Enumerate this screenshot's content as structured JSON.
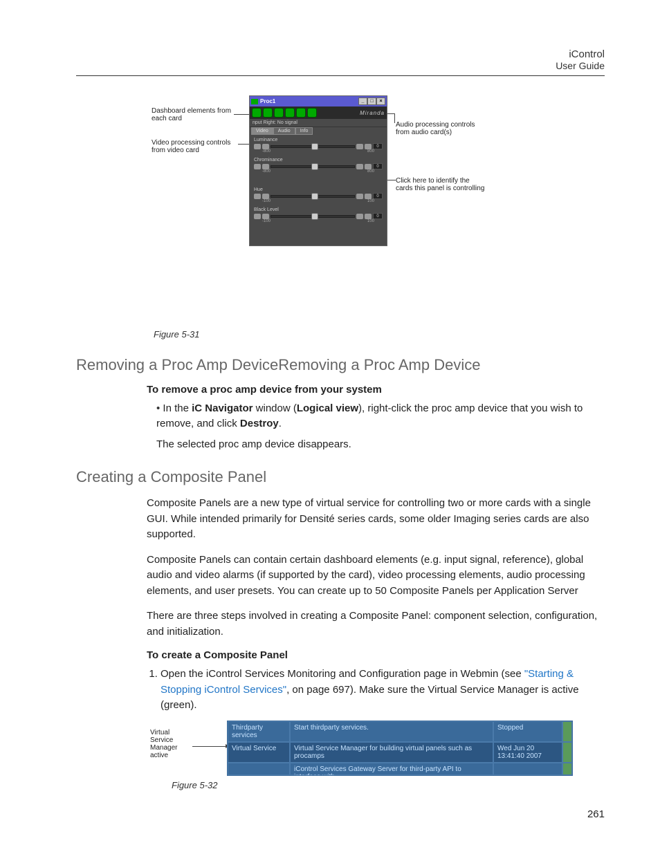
{
  "header": {
    "title": "iControl",
    "sub": "User Guide"
  },
  "figure531": {
    "caption": "Figure 5-31",
    "window_title": "Proc1",
    "brand": "Miranda",
    "signal_row": "nput Right: No signal",
    "tabs": [
      "Video",
      "Audio",
      "Info"
    ],
    "sliders": [
      {
        "label": "Luminance",
        "min": "-800",
        "max": "800",
        "val": "0"
      },
      {
        "label": "Chrominance",
        "min": "-800",
        "max": "800",
        "val": "0"
      },
      {
        "label": "Hue",
        "min": "-100",
        "max": "100",
        "val": "0"
      },
      {
        "label": "Black Level",
        "min": "-100",
        "max": "100",
        "val": "0"
      }
    ],
    "callouts": {
      "dashboard": "Dashboard elements from each card",
      "video": "Video processing controls from video card",
      "audio": "Audio processing controls from audio card(s)",
      "identify": "Click here to identify the cards this panel is controlling"
    }
  },
  "section1": {
    "heading": "Removing a Proc Amp DeviceRemoving a Proc Amp Device",
    "bold": "To remove a proc amp device from your system",
    "bullet_prefix": "In the ",
    "bullet_b1": "iC Navigator",
    "bullet_mid1": " window (",
    "bullet_b2": "Logical view",
    "bullet_mid2": "), right-click the proc amp device that you wish to remove, and click ",
    "bullet_b3": "Destroy",
    "bullet_end": ".",
    "sub": "The selected proc amp device disappears."
  },
  "section2": {
    "heading": "Creating a Composite Panel",
    "p1": "Composite Panels are a new type of virtual service for controlling two or more cards with a single GUI. While intended primarily for Densité series cards, some older Imaging series cards are also supported.",
    "p2": "Composite Panels can contain certain dashboard elements (e.g. input signal, reference), global audio and video alarms (if supported by the card), video processing elements, audio processing elements, and user presets. You can create up to 50 Composite Panels per Application Server",
    "p3": "There are three steps involved in creating a Composite Panel: component selection, configuration, and initialization.",
    "bold": "To create a Composite Panel",
    "li1_a": "Open the iControl Services Monitoring and Configuration page in Webmin (see ",
    "li1_link": "\"Starting & Stopping iControl Services\"",
    "li1_b": ", on page 697). Make sure the Virtual Service Manager is active (green)."
  },
  "figure532": {
    "caption": "Figure 5-32",
    "callout": "Virtual Service Manager active",
    "rows": [
      {
        "c1": "Thirdparty services",
        "c2": "Start thirdparty services.",
        "c3a": "Stopped",
        "c3b": ""
      },
      {
        "c1": "Virtual Service",
        "c2": "Virtual Service Manager for building virtual panels such as procamps",
        "c3a": "Wed Jun 20",
        "c3b": "13:41:40 2007"
      },
      {
        "c1": "",
        "c2": "iControl Services Gateway Server for third-party API to interface with",
        "c3a": "",
        "c3b": ""
      }
    ]
  },
  "pagenum": "261"
}
